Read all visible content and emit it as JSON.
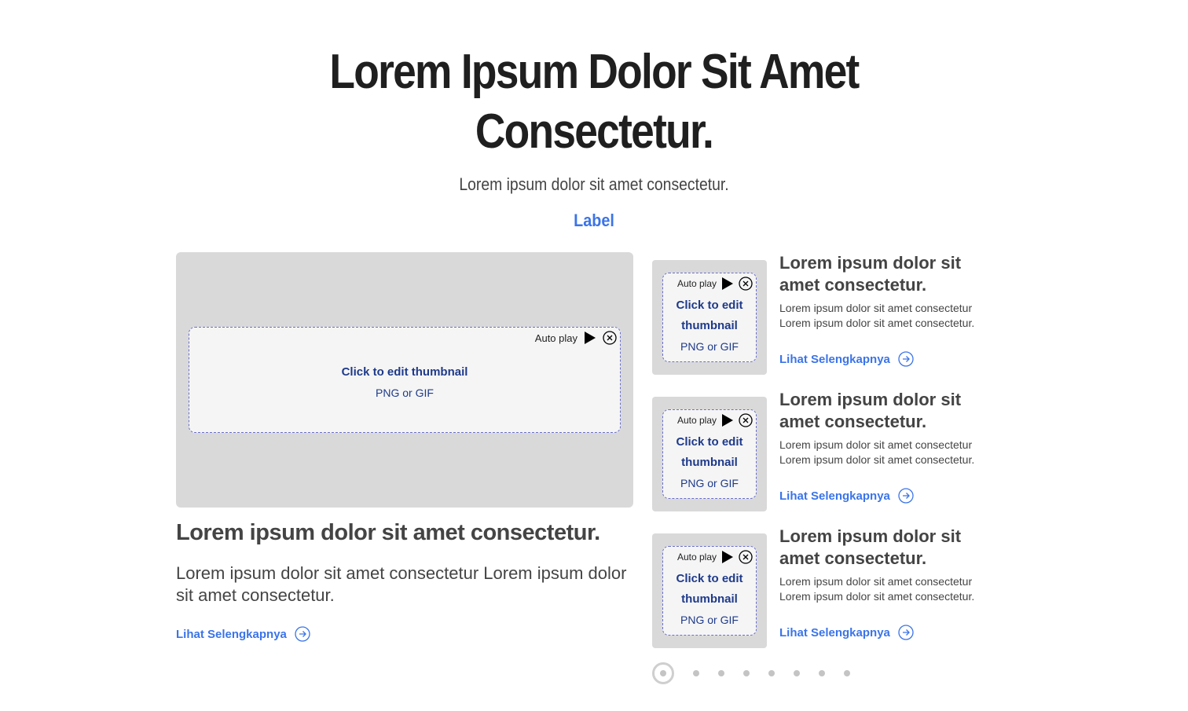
{
  "hero": {
    "title_line1": "Lorem Ipsum Dolor Sit Amet",
    "title_line2": "Consectetur.",
    "subtitle": "Lorem ipsum dolor sit amet consectetur.",
    "label": "Label"
  },
  "upload": {
    "autoplay": "Auto play",
    "click_to_edit": "Click to edit thumbnail",
    "click_line1": "Click to edit",
    "click_line2": "thumbnail",
    "format": "PNG or GIF"
  },
  "featured": {
    "title": "Lorem ipsum dolor sit amet consectetur.",
    "description": "Lorem ipsum dolor sit amet consectetur Lorem ipsum dolor sit amet consectetur.",
    "link": "Lihat Selengkapnya"
  },
  "items": [
    {
      "title": "Lorem ipsum dolor sit amet consectetur.",
      "desc_line1": "Lorem ipsum dolor sit amet consectetur",
      "desc_line2": "Lorem ipsum dolor sit amet consectetur.",
      "link": "Lihat Selengkapnya"
    },
    {
      "title": "Lorem ipsum dolor sit amet consectetur.",
      "desc_line1": "Lorem ipsum dolor sit amet consectetur",
      "desc_line2": "Lorem ipsum dolor sit amet consectetur.",
      "link": "Lihat Selengkapnya"
    },
    {
      "title": "Lorem ipsum dolor sit amet consectetur.",
      "desc_line1": "Lorem ipsum dolor sit amet consectetur",
      "desc_line2": "Lorem ipsum dolor sit amet consectetur.",
      "link": "Lihat Selengkapnya"
    }
  ],
  "pager": {
    "total": 8,
    "active": 1
  },
  "colors": {
    "accent": "#3b74e8",
    "upload_text": "#1e3a8a",
    "media_bg": "#d9d9d9"
  },
  "icons": {
    "play": "play-icon",
    "close": "close-icon",
    "arrow": "arrow-right-circle-icon"
  }
}
